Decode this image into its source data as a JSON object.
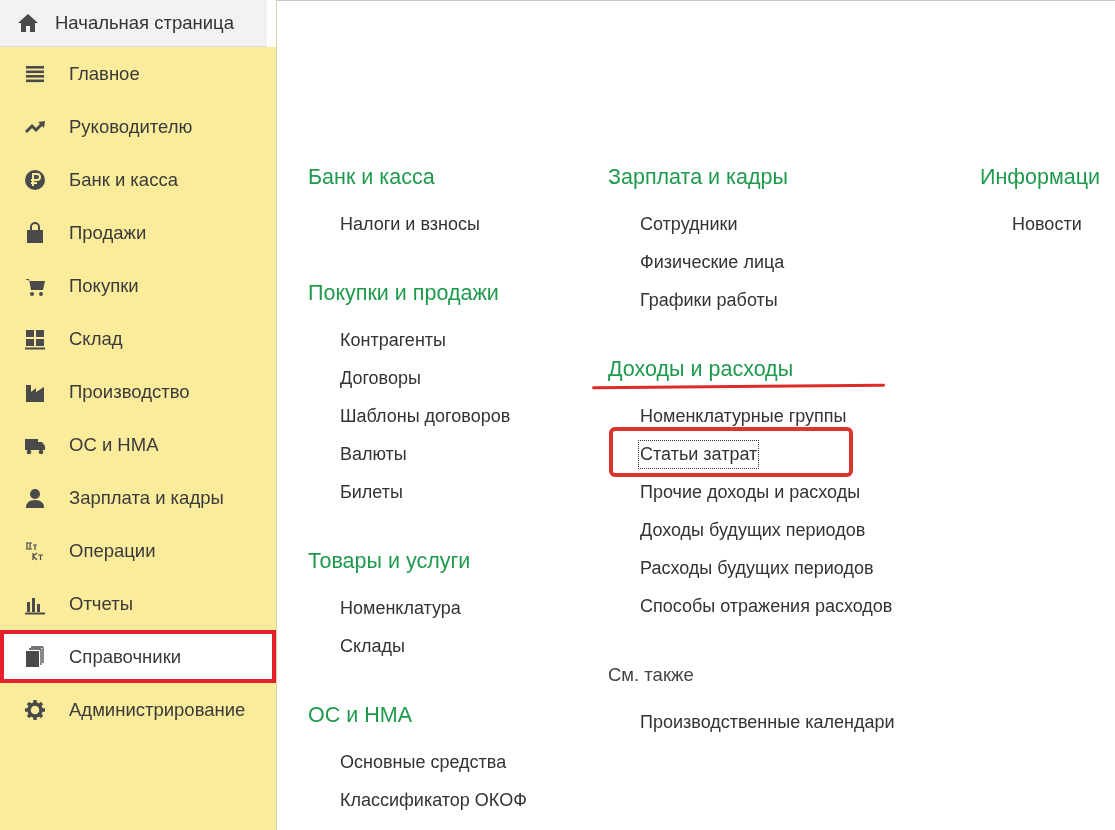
{
  "home_tab": {
    "label": "Начальная страница"
  },
  "sidebar": {
    "items": [
      {
        "label": "Главное",
        "selected": false,
        "annotated": false
      },
      {
        "label": "Руководителю",
        "selected": false,
        "annotated": false
      },
      {
        "label": "Банк и касса",
        "selected": false,
        "annotated": false
      },
      {
        "label": "Продажи",
        "selected": false,
        "annotated": false
      },
      {
        "label": "Покупки",
        "selected": false,
        "annotated": false
      },
      {
        "label": "Склад",
        "selected": false,
        "annotated": false
      },
      {
        "label": "Производство",
        "selected": false,
        "annotated": false
      },
      {
        "label": "ОС и НМА",
        "selected": false,
        "annotated": false
      },
      {
        "label": "Зарплата и кадры",
        "selected": false,
        "annotated": false
      },
      {
        "label": "Операции",
        "selected": false,
        "annotated": false
      },
      {
        "label": "Отчеты",
        "selected": false,
        "annotated": false
      },
      {
        "label": "Справочники",
        "selected": true,
        "annotated": true
      },
      {
        "label": "Администрирование",
        "selected": false,
        "annotated": false
      }
    ]
  },
  "columns": [
    {
      "sections": [
        {
          "kind": "group",
          "title": "Банк и касса",
          "underlined": false,
          "links": [
            {
              "label": "Налоги и взносы",
              "focused": false,
              "annotated": false
            }
          ]
        },
        {
          "kind": "group",
          "title": "Покупки и продажи",
          "underlined": false,
          "links": [
            {
              "label": "Контрагенты",
              "focused": false,
              "annotated": false
            },
            {
              "label": "Договоры",
              "focused": false,
              "annotated": false
            },
            {
              "label": "Шаблоны договоров",
              "focused": false,
              "annotated": false
            },
            {
              "label": "Валюты",
              "focused": false,
              "annotated": false
            },
            {
              "label": "Билеты",
              "focused": false,
              "annotated": false
            }
          ]
        },
        {
          "kind": "group",
          "title": "Товары и услуги",
          "underlined": false,
          "links": [
            {
              "label": "Номенклатура",
              "focused": false,
              "annotated": false
            },
            {
              "label": "Склады",
              "focused": false,
              "annotated": false
            }
          ]
        },
        {
          "kind": "group",
          "title": "ОС и НМА",
          "underlined": false,
          "links": [
            {
              "label": "Основные средства",
              "focused": false,
              "annotated": false
            },
            {
              "label": "Классификатор ОКОФ",
              "focused": false,
              "annotated": false
            }
          ]
        }
      ]
    },
    {
      "sections": [
        {
          "kind": "group",
          "title": "Зарплата и кадры",
          "underlined": false,
          "links": [
            {
              "label": "Сотрудники",
              "focused": false,
              "annotated": false
            },
            {
              "label": "Физические лица",
              "focused": false,
              "annotated": false
            },
            {
              "label": "Графики работы",
              "focused": false,
              "annotated": false
            }
          ]
        },
        {
          "kind": "group",
          "title": "Доходы и расходы",
          "underlined": true,
          "links": [
            {
              "label": "Номенклатурные группы",
              "focused": false,
              "annotated": false
            },
            {
              "label": "Статьи затрат",
              "focused": true,
              "annotated": true
            },
            {
              "label": "Прочие доходы и расходы",
              "focused": false,
              "annotated": false
            },
            {
              "label": "Доходы будущих периодов",
              "focused": false,
              "annotated": false
            },
            {
              "label": "Расходы будущих периодов",
              "focused": false,
              "annotated": false
            },
            {
              "label": "Способы отражения расходов",
              "focused": false,
              "annotated": false
            }
          ]
        },
        {
          "kind": "see_also",
          "title": "См. также",
          "underlined": false,
          "links": [
            {
              "label": "Производственные календари",
              "focused": false,
              "annotated": false
            }
          ]
        }
      ]
    },
    {
      "sections": [
        {
          "kind": "group",
          "title": "Информаци",
          "underlined": false,
          "links": [
            {
              "label": "Новости",
              "focused": false,
              "annotated": false
            }
          ]
        }
      ]
    }
  ]
}
